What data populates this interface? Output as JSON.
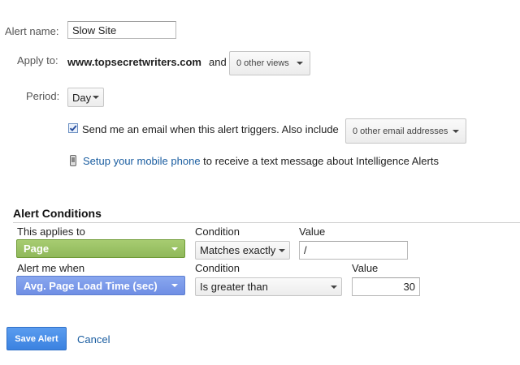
{
  "colors": {
    "link": "#1a5da0",
    "page_dimension_bg": "#9bc266",
    "metric_bg": "#7c9be9",
    "save_button_bg": "#4a8fe8"
  },
  "form": {
    "alert_name_label": "Alert name:",
    "alert_name_value": "Slow Site",
    "apply_to_label": "Apply to:",
    "site": "www.topsecretwriters.com",
    "and_text": "and",
    "other_views": "0 other views",
    "period_label": "Period:",
    "period_value": "Day",
    "email_checkbox_checked": true,
    "email_text": "Send me an email when this alert triggers. Also include",
    "other_emails": "0 other email addresses",
    "phone_link": "Setup your mobile phone",
    "phone_text": "to receive a text message about Intelligence Alerts"
  },
  "conditions": {
    "heading": "Alert Conditions",
    "applies_to_label": "This applies to",
    "applies_to_value": "Page",
    "condition_label_1": "Condition",
    "condition_value_1": "Matches exactly",
    "value_label_1": "Value",
    "value_1": "/",
    "alert_when_label": "Alert me when",
    "alert_when_value": "Avg. Page Load Time (sec)",
    "condition_label_2": "Condition",
    "condition_value_2": "Is greater than",
    "value_label_2": "Value",
    "value_2": "30"
  },
  "actions": {
    "save_label": "Save Alert",
    "cancel_label": "Cancel"
  }
}
